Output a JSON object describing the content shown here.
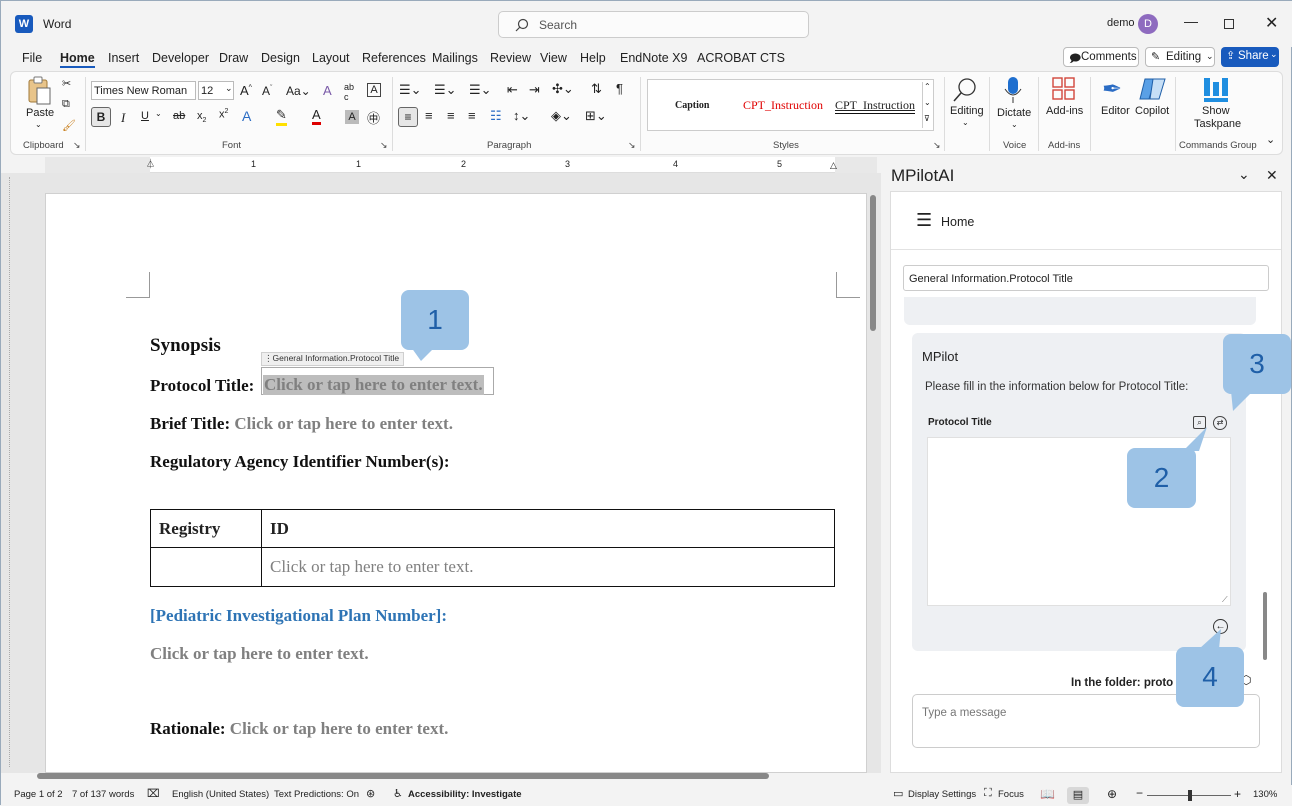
{
  "app": {
    "name": "Word",
    "user": "demo",
    "avatar": "D"
  },
  "search": {
    "placeholder": "Search"
  },
  "menu": [
    "File",
    "Home",
    "Insert",
    "Developer",
    "Draw",
    "Design",
    "Layout",
    "References",
    "Mailings",
    "Review",
    "View",
    "Help",
    "EndNote X9",
    "ACROBAT",
    "CTS"
  ],
  "topright": {
    "comments": "Comments",
    "editing": "Editing",
    "share": "Share"
  },
  "ribbon": {
    "paste": "Paste",
    "font_name": "Times New Roman B",
    "font_size": "12",
    "styles": {
      "caption": "Caption",
      "s1": "CPT_Instruction",
      "s2": "CPT_Instruction"
    },
    "editing": "Editing",
    "dictate": "Dictate",
    "addins": "Add-ins",
    "editor": "Editor",
    "copilot": "Copilot",
    "show": "Show",
    "taskpane": "Taskpane",
    "groups": {
      "clipboard": "Clipboard",
      "font": "Font",
      "paragraph": "Paragraph",
      "styles": "Styles",
      "voice": "Voice",
      "addins": "Add-ins",
      "commands": "Commands Group"
    }
  },
  "ruler": [
    "1",
    "1",
    "2",
    "3",
    "4",
    "5",
    "6"
  ],
  "document": {
    "content_control_tag": "General Information.Protocol Title",
    "synopsis": "Synopsis",
    "protocol_label": "Protocol Title:",
    "placeholder": "Click or tap here to enter text.",
    "brief_label": "Brief Title:",
    "regulatory": "Regulatory Agency Identifier Number(s):",
    "table": {
      "h1": "Registry",
      "h2": "ID",
      "cell": "Click or tap here to enter text."
    },
    "pediatric": "[Pediatric Investigational Plan Number]:",
    "rationale_label": "Rationale:"
  },
  "panel": {
    "title": "MPilotAI",
    "home": "Home",
    "field": "General Information.Protocol Title",
    "card_title": "MPilot",
    "instruction": "Please fill in the information below for Protocol Title:",
    "field_label": "Protocol Title",
    "folder": "In the folder: proto",
    "message_placeholder": "Type a message"
  },
  "callouts": [
    "1",
    "2",
    "3",
    "4"
  ],
  "status": {
    "page": "Page 1 of 2",
    "words": "7 of 137 words",
    "lang": "English (United States)",
    "pred": "Text Predictions: On",
    "access": "Accessibility: Investigate",
    "display": "Display Settings",
    "focus": "Focus",
    "zoom": "130%"
  },
  "colors": {
    "accent": "#185abd",
    "callout": "#9dc3e6",
    "link_blue": "#2e74b5"
  }
}
